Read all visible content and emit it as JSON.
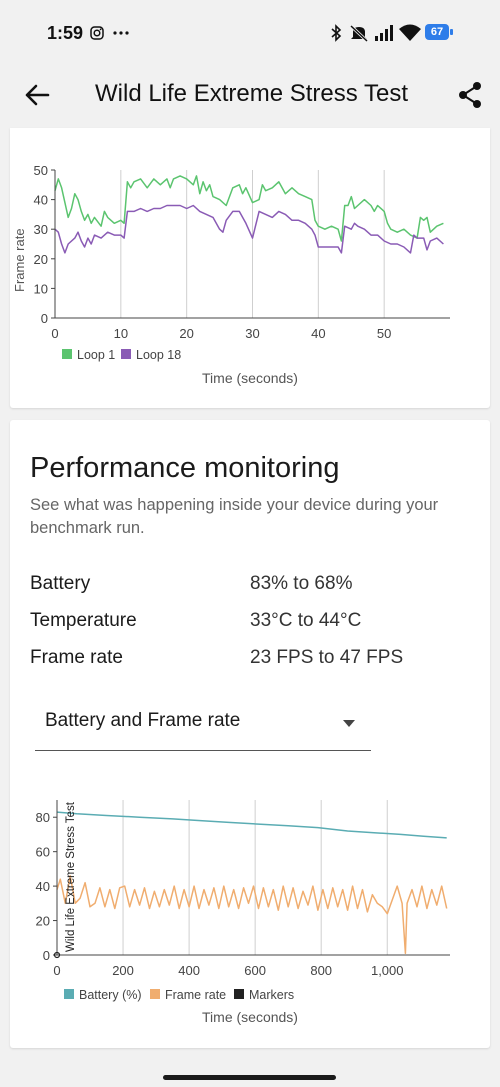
{
  "status_bar": {
    "time": "1:59",
    "battery_level": "67"
  },
  "app_bar": {
    "title": "Wild Life Extreme Stress Test"
  },
  "frame_chart": {
    "chart_data": {
      "type": "line",
      "ylabel": "Frame rate",
      "xlabel": "Time (seconds)",
      "x_ticks": [
        "0",
        "10",
        "20",
        "30",
        "40",
        "50"
      ],
      "y_ticks": [
        "0",
        "10",
        "20",
        "30",
        "40",
        "50"
      ],
      "xlim": [
        0,
        60
      ],
      "ylim": [
        0,
        50
      ],
      "grid": "vertical",
      "legend_position": "bottom-left",
      "series": [
        {
          "name": "Loop 1",
          "color": "#5bc46f",
          "points": [
            [
              0,
              43
            ],
            [
              0.5,
              47
            ],
            [
              1,
              44
            ],
            [
              1.5,
              39
            ],
            [
              2,
              34
            ],
            [
              2.5,
              37
            ],
            [
              3,
              42
            ],
            [
              3.5,
              40
            ],
            [
              4,
              36
            ],
            [
              4.5,
              33
            ],
            [
              5,
              35
            ],
            [
              5.5,
              32
            ],
            [
              6,
              34
            ],
            [
              7,
              31
            ],
            [
              7.5,
              36
            ],
            [
              8,
              34
            ],
            [
              9,
              32
            ],
            [
              10,
              33
            ],
            [
              10.5,
              32
            ],
            [
              11,
              46
            ],
            [
              11.5,
              44
            ],
            [
              12,
              46
            ],
            [
              13,
              47
            ],
            [
              14,
              44
            ],
            [
              15,
              47
            ],
            [
              16,
              45
            ],
            [
              17,
              47
            ],
            [
              17.5,
              44
            ],
            [
              18,
              47
            ],
            [
              19,
              48
            ],
            [
              20,
              47
            ],
            [
              21,
              45
            ],
            [
              21.5,
              48
            ],
            [
              22,
              42
            ],
            [
              22.5,
              46
            ],
            [
              23,
              43
            ],
            [
              23.5,
              45
            ],
            [
              24,
              41
            ],
            [
              25,
              40
            ],
            [
              26,
              38
            ],
            [
              27,
              44
            ],
            [
              28,
              45
            ],
            [
              28.5,
              42
            ],
            [
              29,
              44
            ],
            [
              30,
              39
            ],
            [
              31,
              40
            ],
            [
              31.5,
              45
            ],
            [
              32,
              43
            ],
            [
              33,
              44
            ],
            [
              34,
              46
            ],
            [
              35,
              42
            ],
            [
              36,
              44
            ],
            [
              37,
              42
            ],
            [
              38,
              41
            ],
            [
              39,
              40
            ],
            [
              39.5,
              33
            ],
            [
              40,
              31
            ],
            [
              41,
              30
            ],
            [
              42,
              31
            ],
            [
              43,
              30
            ],
            [
              43.5,
              26
            ],
            [
              44,
              38
            ],
            [
              44.5,
              38
            ],
            [
              45,
              41
            ],
            [
              45.5,
              37
            ],
            [
              46,
              38
            ],
            [
              47,
              40
            ],
            [
              48,
              38
            ],
            [
              48.5,
              36
            ],
            [
              49,
              38
            ],
            [
              50,
              36
            ],
            [
              50.5,
              32
            ],
            [
              51,
              30
            ],
            [
              52,
              29
            ],
            [
              53,
              30
            ],
            [
              54,
              28
            ],
            [
              55,
              27
            ],
            [
              55.5,
              34
            ],
            [
              56,
              33
            ],
            [
              56.5,
              34
            ],
            [
              57,
              29
            ],
            [
              58,
              31
            ],
            [
              59,
              32
            ]
          ]
        },
        {
          "name": "Loop 18",
          "color": "#8a5bb5",
          "points": [
            [
              0,
              30
            ],
            [
              0.5,
              29
            ],
            [
              1,
              25
            ],
            [
              1.5,
              22
            ],
            [
              2,
              25
            ],
            [
              3,
              27
            ],
            [
              3.5,
              29
            ],
            [
              4,
              26
            ],
            [
              4.5,
              24
            ],
            [
              5,
              27
            ],
            [
              5.5,
              25
            ],
            [
              6,
              28
            ],
            [
              7,
              27
            ],
            [
              8,
              29
            ],
            [
              9,
              28
            ],
            [
              10,
              28
            ],
            [
              10.5,
              27
            ],
            [
              11,
              36
            ],
            [
              12,
              36
            ],
            [
              13,
              37
            ],
            [
              14,
              36
            ],
            [
              15,
              37
            ],
            [
              16,
              37
            ],
            [
              17,
              38
            ],
            [
              18,
              38
            ],
            [
              19,
              38
            ],
            [
              20,
              37
            ],
            [
              21,
              38
            ],
            [
              22,
              36
            ],
            [
              23,
              35
            ],
            [
              24,
              34
            ],
            [
              25,
              30
            ],
            [
              25.5,
              29
            ],
            [
              26,
              33
            ],
            [
              27,
              36
            ],
            [
              28,
              36
            ],
            [
              29,
              32
            ],
            [
              30,
              27
            ],
            [
              31,
              36
            ],
            [
              32,
              35
            ],
            [
              33,
              34
            ],
            [
              34,
              36
            ],
            [
              35,
              35
            ],
            [
              36,
              33
            ],
            [
              37,
              33
            ],
            [
              38,
              32
            ],
            [
              39,
              30
            ],
            [
              39.5,
              28
            ],
            [
              40,
              24
            ],
            [
              41,
              24
            ],
            [
              42,
              24
            ],
            [
              43,
              24
            ],
            [
              43.5,
              22
            ],
            [
              44,
              31
            ],
            [
              45,
              30
            ],
            [
              45.5,
              32
            ],
            [
              46,
              31
            ],
            [
              47,
              30
            ],
            [
              48,
              28
            ],
            [
              49,
              28
            ],
            [
              50,
              26
            ],
            [
              51,
              25
            ],
            [
              52,
              25
            ],
            [
              53,
              24
            ],
            [
              54,
              22
            ],
            [
              54.5,
              28
            ],
            [
              55,
              27
            ],
            [
              56,
              27
            ],
            [
              56.5,
              23
            ],
            [
              57,
              26
            ],
            [
              58,
              27
            ],
            [
              59,
              25
            ]
          ]
        }
      ]
    }
  },
  "performance": {
    "title": "Performance monitoring",
    "description": "See what was happening inside your device during your benchmark run.",
    "battery_label": "Battery",
    "battery_value": "83% to 68%",
    "temperature_label": "Temperature",
    "temperature_value": "33°C to 44°C",
    "framerate_label": "Frame rate",
    "framerate_value": "23 FPS to 47 FPS",
    "dropdown": {
      "selected": "Battery and Frame rate"
    }
  },
  "battery_chart": {
    "chart_data": {
      "type": "line",
      "xlabel": "Time (seconds)",
      "marker_label": "Wild Life Extreme Stress Test",
      "x_ticks": [
        "0",
        "200",
        "400",
        "600",
        "800",
        "1,000"
      ],
      "y_ticks": [
        "0",
        "20",
        "40",
        "60",
        "80"
      ],
      "xlim": [
        0,
        1190
      ],
      "ylim": [
        0,
        90
      ],
      "grid": "vertical",
      "legend_position": "bottom-left",
      "series": [
        {
          "name": "Battery (%)",
          "color": "#5aacb3",
          "points": [
            [
              0,
              83
            ],
            [
              60,
              82
            ],
            [
              150,
              81
            ],
            [
              250,
              80
            ],
            [
              350,
              79
            ],
            [
              440,
              78
            ],
            [
              520,
              77
            ],
            [
              610,
              76
            ],
            [
              700,
              75
            ],
            [
              790,
              74
            ],
            [
              880,
              72
            ],
            [
              960,
              71
            ],
            [
              1040,
              70
            ],
            [
              1110,
              69
            ],
            [
              1180,
              68
            ]
          ]
        },
        {
          "name": "Frame rate",
          "color": "#f0ad6f",
          "points": [
            [
              0,
              38
            ],
            [
              10,
              44
            ],
            [
              25,
              30
            ],
            [
              40,
              46
            ],
            [
              55,
              30
            ],
            [
              70,
              33
            ],
            [
              85,
              42
            ],
            [
              100,
              28
            ],
            [
              115,
              30
            ],
            [
              130,
              39
            ],
            [
              145,
              28
            ],
            [
              160,
              38
            ],
            [
              175,
              27
            ],
            [
              190,
              39
            ],
            [
              205,
              40
            ],
            [
              220,
              28
            ],
            [
              235,
              38
            ],
            [
              250,
              29
            ],
            [
              265,
              39
            ],
            [
              280,
              27
            ],
            [
              295,
              37
            ],
            [
              310,
              28
            ],
            [
              325,
              38
            ],
            [
              340,
              29
            ],
            [
              355,
              40
            ],
            [
              370,
              27
            ],
            [
              385,
              38
            ],
            [
              400,
              28
            ],
            [
              415,
              40
            ],
            [
              430,
              27
            ],
            [
              445,
              38
            ],
            [
              460,
              29
            ],
            [
              475,
              39
            ],
            [
              490,
              27
            ],
            [
              505,
              40
            ],
            [
              520,
              28
            ],
            [
              535,
              38
            ],
            [
              550,
              27
            ],
            [
              565,
              39
            ],
            [
              580,
              30
            ],
            [
              595,
              40
            ],
            [
              610,
              27
            ],
            [
              625,
              39
            ],
            [
              640,
              28
            ],
            [
              655,
              38
            ],
            [
              670,
              26
            ],
            [
              685,
              40
            ],
            [
              700,
              28
            ],
            [
              715,
              39
            ],
            [
              730,
              27
            ],
            [
              745,
              37
            ],
            [
              760,
              29
            ],
            [
              775,
              40
            ],
            [
              790,
              26
            ],
            [
              805,
              38
            ],
            [
              820,
              27
            ],
            [
              835,
              39
            ],
            [
              850,
              28
            ],
            [
              865,
              38
            ],
            [
              880,
              26
            ],
            [
              895,
              40
            ],
            [
              910,
              27
            ],
            [
              925,
              38
            ],
            [
              940,
              25
            ],
            [
              955,
              35
            ],
            [
              970,
              30
            ],
            [
              985,
              28
            ],
            [
              1000,
              24
            ],
            [
              1030,
              40
            ],
            [
              1045,
              30
            ],
            [
              1055,
              1
            ],
            [
              1060,
              30
            ],
            [
              1075,
              38
            ],
            [
              1090,
              28
            ],
            [
              1105,
              40
            ],
            [
              1120,
              27
            ],
            [
              1135,
              38
            ],
            [
              1150,
              29
            ],
            [
              1165,
              40
            ],
            [
              1180,
              27
            ]
          ]
        },
        {
          "name": "Markers",
          "color": "#222222",
          "points": [
            [
              0,
              0
            ]
          ]
        }
      ]
    }
  }
}
